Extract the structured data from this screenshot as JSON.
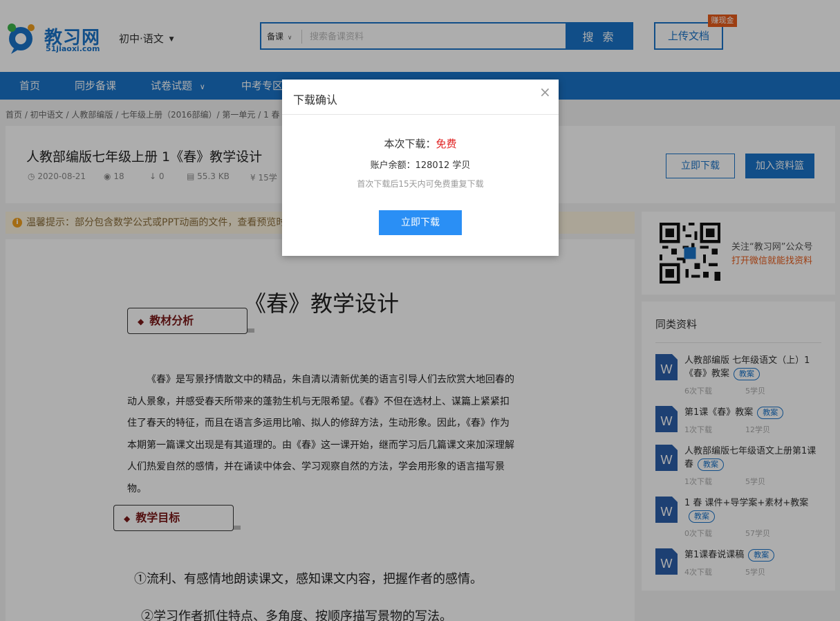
{
  "header": {
    "logo_text": "教习网",
    "logo_sub": "51jiaoxi.com",
    "subject": "初中·语文",
    "search_category": "备课",
    "search_placeholder": "搜索备课资料",
    "search_button": "搜 索",
    "upload_button": "上传文档",
    "earn_badge": "赚现金"
  },
  "nav": {
    "items": [
      "首页",
      "同步备课",
      "试卷试题",
      "中考专区"
    ]
  },
  "breadcrumb": "首页 / 初中语文 / 人教部编版 / 七年级上册（2016部编）/ 第一单元 / 1 春",
  "doc_info": {
    "title": "人教部编版七年级上册 1《春》教学设计",
    "date": "2020-08-21",
    "views": "18",
    "downloads": "0",
    "size": "55.3 KB",
    "price": "15学",
    "download_button": "立即下载",
    "basket_button": "加入资料篮"
  },
  "tip": {
    "text": "温馨提示：部分包含数学公式或PPT动画的文件，查看预览时"
  },
  "document": {
    "heading": "《春》教学设计",
    "section1": "教材分析",
    "paragraph": "《春》是写景抒情散文中的精品，朱自清以清新优美的语言引导人们去欣赏大地回春的动人景象，并感受春天所带来的蓬勃生机与无限希望。《春》不但在选材上、谋篇上紧紧扣住了春天的特征，而且在语言多运用比喻、拟人的修辞方法，生动形象。因此，《春》作为本期第一篇课文出现是有其道理的。由《春》这一课开始，继而学习后几篇课文来加深理解人们热爱自然的感情，并在诵读中体会、学习观察自然的方法，学会用形象的语言描写景物。",
    "section2": "教学目标",
    "goal1": "①流利、有感情地朗读课文，感知课文内容，把握作者的感情。",
    "goal2": "②学习作者抓住特点、多角度、按顺序描写景物的写法。"
  },
  "qr": {
    "line1": "关注“教习网”公众号",
    "line2": "打开微信就能找资料"
  },
  "similar": {
    "title": "同类资料",
    "items": [
      {
        "title": "人教部编版 七年级语文（上）1《春》教案",
        "tag": "教案",
        "downloads": "6次下载",
        "price": "5学贝"
      },
      {
        "title": "第1课《春》教案",
        "tag": "教案",
        "downloads": "1次下载",
        "price": "12学贝"
      },
      {
        "title": "人教部编版七年级语文上册第1课 春",
        "tag": "教案",
        "downloads": "1次下载",
        "price": "5学贝"
      },
      {
        "title": "1 春 课件+导学案+素材+教案",
        "tag": "教案",
        "downloads": "0次下载",
        "price": "57学贝"
      },
      {
        "title": "第1课春说课稿",
        "tag": "教案",
        "downloads": "4次下载",
        "price": "5学贝"
      }
    ]
  },
  "modal": {
    "title": "下载确认",
    "close": "×",
    "cost_label": "本次下载：",
    "cost_value": "免费",
    "balance": "账户余额：128012 学贝",
    "note": "首次下载后15天内可免费重复下载",
    "button": "立即下载"
  },
  "colors": {
    "brand": "#1a73c9",
    "accent_orange": "#e85c1b",
    "free_red": "#e02020",
    "modal_button": "#2a8ff5"
  }
}
